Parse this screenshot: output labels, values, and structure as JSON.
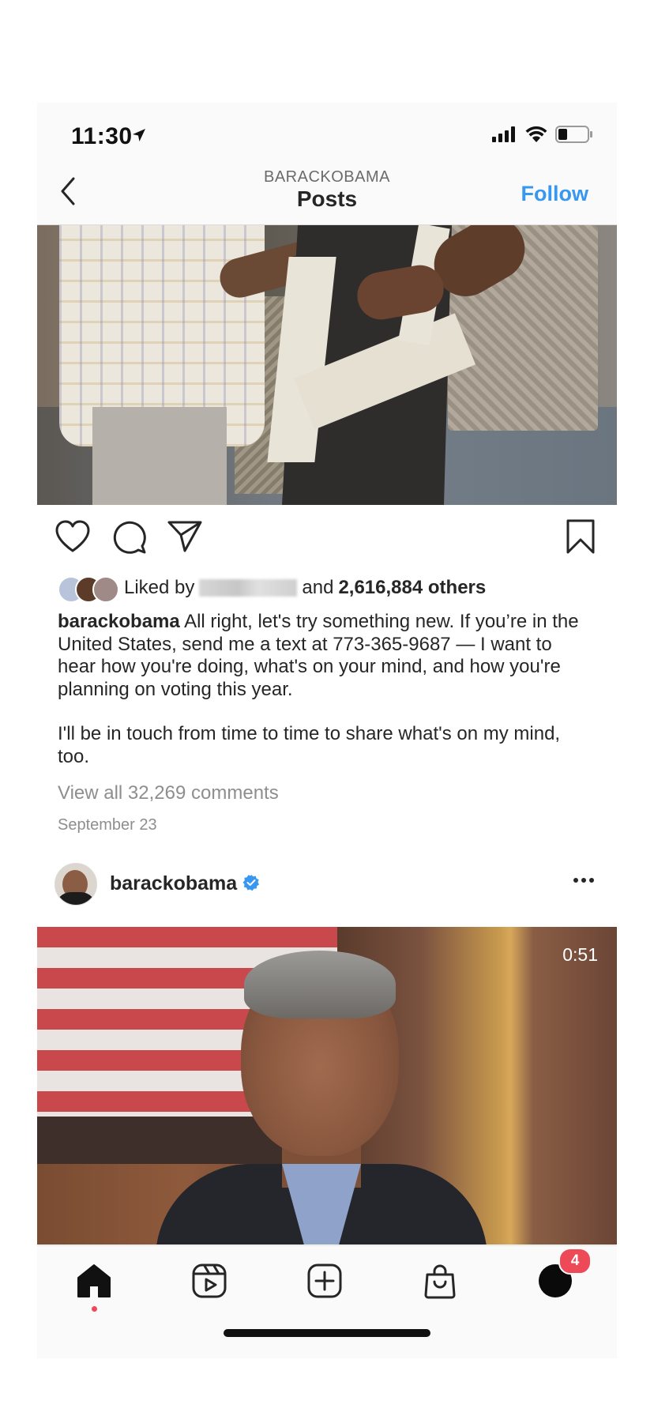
{
  "status_bar": {
    "time": "11:30",
    "icons": [
      "location-arrow-icon",
      "signal-icon",
      "wifi-icon",
      "battery-icon"
    ]
  },
  "header": {
    "account": "BARACKOBAMA",
    "title": "Posts",
    "follow_label": "Follow"
  },
  "post1": {
    "liked_by_prefix": "Liked by",
    "liked_and": "and",
    "liked_others": "2,616,884 others",
    "caption_user": "barackobama",
    "caption_text": "All right, let's try something new. If you’re in the United States, send me a text at 773-365-9687 — I want to hear how you're doing, what's on your mind, and how you're planning on voting this year.",
    "caption_text_2": "I'll be in touch from time to time to share what's on my mind, too.",
    "view_comments": "View all 32,269 comments",
    "date": "September 23"
  },
  "post2": {
    "username": "barackobama",
    "verified": true,
    "video_duration": "0:51"
  },
  "tab_bar": {
    "items": [
      "home-icon",
      "reels-icon",
      "new-post-icon",
      "shop-icon",
      "profile-icon"
    ],
    "notification_count": "4"
  },
  "colors": {
    "accent": "#3897f0",
    "badge": "#ed4956",
    "text": "#262626",
    "muted": "#8e8e8e"
  }
}
